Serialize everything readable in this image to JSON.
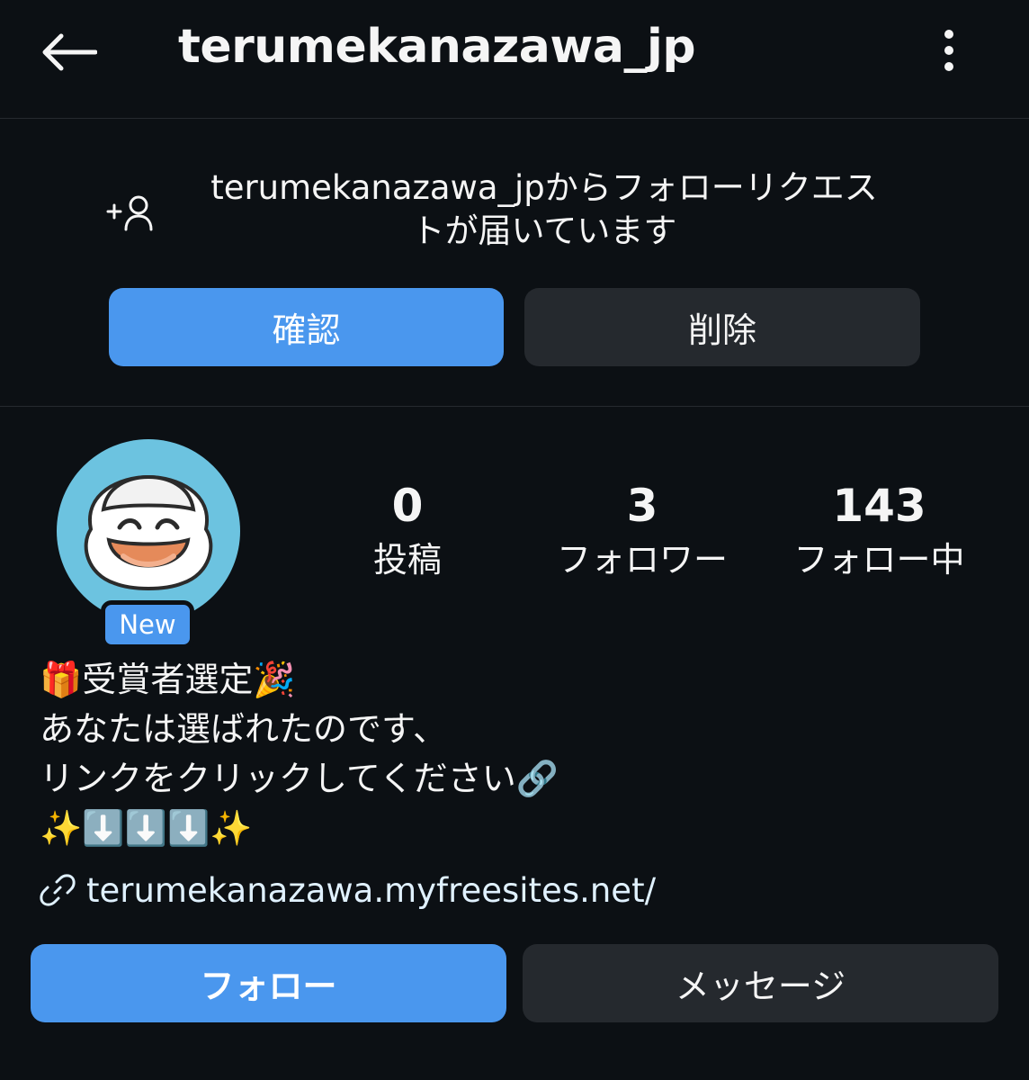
{
  "header": {
    "username": "terumekanazawa_jp",
    "back_icon": "arrow-left-icon",
    "more_icon": "more-vertical-icon"
  },
  "follow_request": {
    "icon": "person-add-icon",
    "line1": "terumekanazawa_jpからフォローリクエス",
    "line2": "トが届いています",
    "confirm_label": "確認",
    "delete_label": "削除"
  },
  "profile": {
    "badge": "New",
    "stats": [
      {
        "value": "0",
        "label": "投稿"
      },
      {
        "value": "3",
        "label": "フォロワー"
      },
      {
        "value": "143",
        "label": "フォロー中"
      }
    ],
    "bio_lines": [
      "🎁受賞者選定🎉",
      "あなたは選ばれたのです、",
      " リンクをクリックしてください🔗",
      "✨⬇️⬇️⬇️✨"
    ],
    "link": "terumekanazawa.myfreesites.net/",
    "link_icon": "link-icon"
  },
  "actions": {
    "follow_label": "フォロー",
    "message_label": "メッセージ"
  },
  "colors": {
    "background": "#0c1014",
    "primary": "#4a97ee",
    "secondary": "#25292e",
    "avatar_bg": "#6cc3e0",
    "link": "#e0f1ff"
  }
}
